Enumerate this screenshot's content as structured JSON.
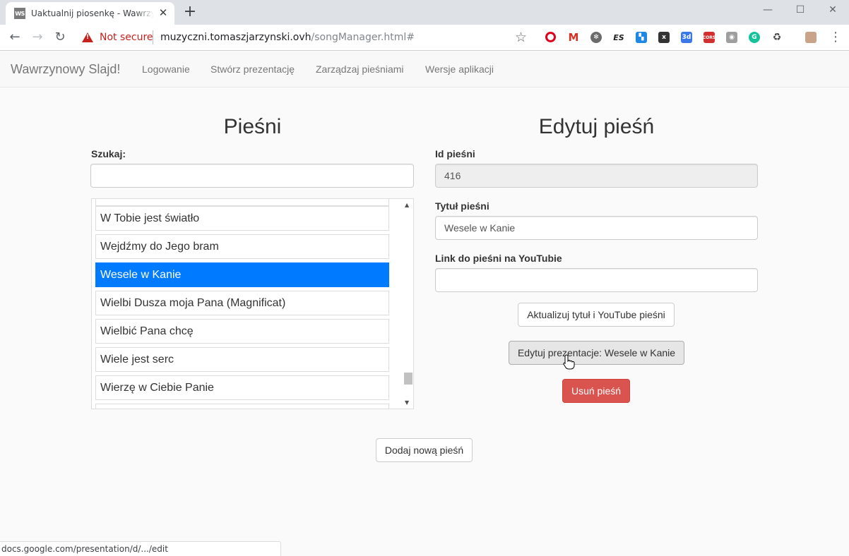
{
  "browser": {
    "tab_title": "Uaktualnij piosenkę - Wawrzynowy Slajd!",
    "favicon_text": "WS",
    "security_label": "Not secure",
    "url_host": "muzyczni.tomaszjarzynski.ovh",
    "url_path": "/songManager.html#",
    "status_url": "docs.google.com/presentation/d/.../edit"
  },
  "navbar": {
    "brand": "Wawrzynowy Slajd!",
    "links": [
      "Logowanie",
      "Stwórz prezentację",
      "Zarządzaj pieśniami",
      "Wersje aplikacji"
    ]
  },
  "songs_panel": {
    "heading": "Pieśni",
    "search_label": "Szukaj:",
    "search_value": "",
    "items": [
      "W Tobie jest światło",
      "Wejdźmy do Jego bram",
      "Wesele w Kanie",
      "Wielbi Dusza moja Pana (Magnificat)",
      "Wielbić Pana chcę",
      "Wiele jest serc",
      "Wierzę w Ciebie Panie"
    ],
    "selected": "Wesele w Kanie"
  },
  "edit_panel": {
    "heading": "Edytuj pieśń",
    "id_label": "Id pieśni",
    "id_value": "416",
    "title_label": "Tytuł pieśni",
    "title_value": "Wesele w Kanie",
    "youtube_label": "Link do pieśni na YouTubie",
    "youtube_value": "",
    "update_button": "Aktualizuj tytuł i YouTube pieśni",
    "edit_presentation_button": "Edytuj prezentacje: Wesele w Kanie",
    "delete_button": "Usuń pieśń"
  },
  "add_button": "Dodaj nową pieśń",
  "colors": {
    "selected_item": "#007bff",
    "danger": "#d9534f",
    "not_secure": "#c5221f"
  }
}
